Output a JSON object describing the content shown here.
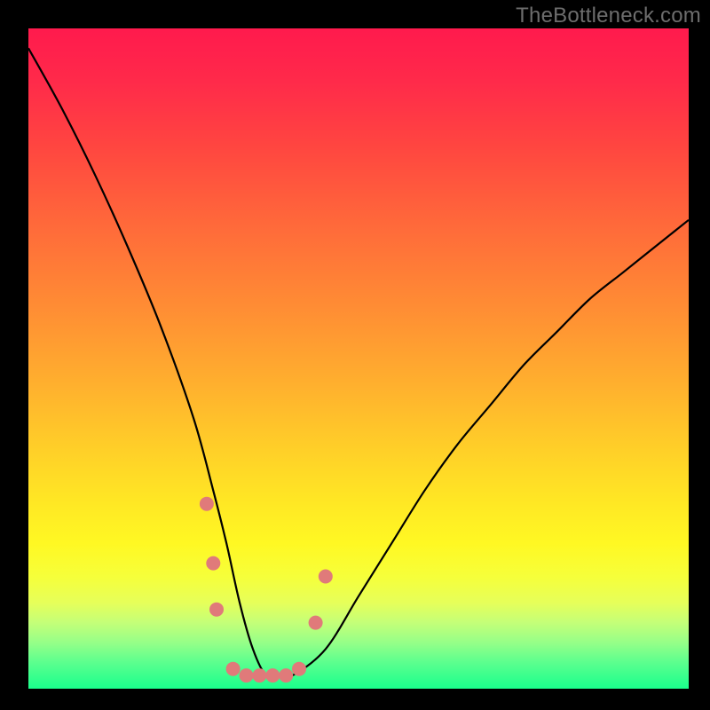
{
  "watermark": "TheBottleneck.com",
  "chart_data": {
    "type": "line",
    "title": "",
    "xlabel": "",
    "ylabel": "",
    "xlim": [
      0,
      100
    ],
    "ylim": [
      0,
      100
    ],
    "grid": false,
    "legend": false,
    "background_gradient": {
      "stops": [
        {
          "pos": 0,
          "color": "#ff1a4d"
        },
        {
          "pos": 50,
          "color": "#ffb02e"
        },
        {
          "pos": 78,
          "color": "#fff823"
        },
        {
          "pos": 100,
          "color": "#1aff8c"
        }
      ]
    },
    "series": [
      {
        "name": "bottleneck-curve",
        "x": [
          0,
          5,
          10,
          15,
          20,
          25,
          28,
          30,
          32,
          34,
          36,
          38,
          40,
          45,
          50,
          55,
          60,
          65,
          70,
          75,
          80,
          85,
          90,
          95,
          100
        ],
        "y": [
          97,
          88,
          78,
          67,
          55,
          41,
          30,
          22,
          13,
          6,
          2,
          2,
          2,
          6,
          14,
          22,
          30,
          37,
          43,
          49,
          54,
          59,
          63,
          67,
          71
        ]
      }
    ],
    "markers": [
      {
        "x": 27.0,
        "y": 28,
        "r": 8,
        "color": "#e07a7a"
      },
      {
        "x": 28.0,
        "y": 19,
        "r": 8,
        "color": "#e07a7a"
      },
      {
        "x": 28.5,
        "y": 12,
        "r": 8,
        "color": "#e07a7a"
      },
      {
        "x": 31.0,
        "y": 3,
        "r": 8,
        "color": "#e07a7a"
      },
      {
        "x": 33.0,
        "y": 2,
        "r": 8,
        "color": "#e07a7a"
      },
      {
        "x": 35.0,
        "y": 2,
        "r": 8,
        "color": "#e07a7a"
      },
      {
        "x": 37.0,
        "y": 2,
        "r": 8,
        "color": "#e07a7a"
      },
      {
        "x": 39.0,
        "y": 2,
        "r": 8,
        "color": "#e07a7a"
      },
      {
        "x": 41.0,
        "y": 3,
        "r": 8,
        "color": "#e07a7a"
      },
      {
        "x": 43.5,
        "y": 10,
        "r": 8,
        "color": "#e07a7a"
      },
      {
        "x": 45.0,
        "y": 17,
        "r": 8,
        "color": "#e07a7a"
      }
    ],
    "notes": "x-axis and y-axis have no visible tick labels; values estimated as 0-100 range. V-shaped bottleneck curve with trough near x≈36, y≈2. Salmon circular markers cluster around the trough."
  },
  "colors": {
    "frame": "#000000",
    "curve": "#000000",
    "marker_fill": "#e07a7a",
    "watermark": "#6d6d6d"
  }
}
